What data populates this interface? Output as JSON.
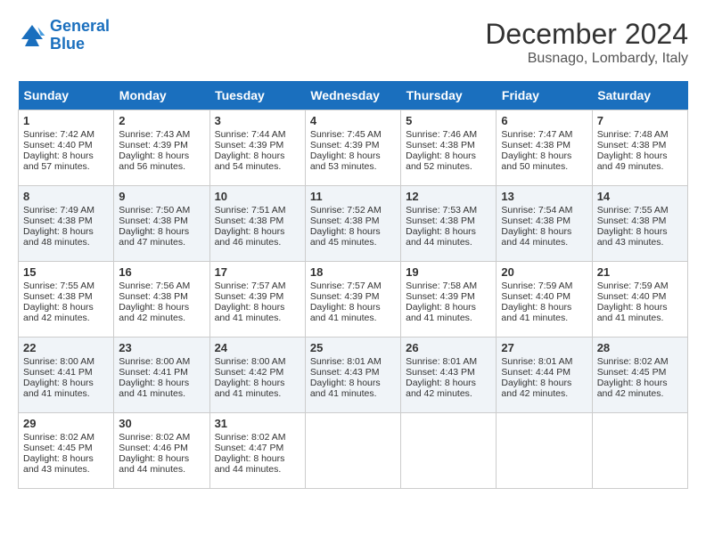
{
  "header": {
    "logo_line1": "General",
    "logo_line2": "Blue",
    "month": "December 2024",
    "location": "Busnago, Lombardy, Italy"
  },
  "weekdays": [
    "Sunday",
    "Monday",
    "Tuesday",
    "Wednesday",
    "Thursday",
    "Friday",
    "Saturday"
  ],
  "weeks": [
    [
      {
        "day": 1,
        "lines": [
          "Sunrise: 7:42 AM",
          "Sunset: 4:40 PM",
          "Daylight: 8 hours",
          "and 57 minutes."
        ]
      },
      {
        "day": 2,
        "lines": [
          "Sunrise: 7:43 AM",
          "Sunset: 4:39 PM",
          "Daylight: 8 hours",
          "and 56 minutes."
        ]
      },
      {
        "day": 3,
        "lines": [
          "Sunrise: 7:44 AM",
          "Sunset: 4:39 PM",
          "Daylight: 8 hours",
          "and 54 minutes."
        ]
      },
      {
        "day": 4,
        "lines": [
          "Sunrise: 7:45 AM",
          "Sunset: 4:39 PM",
          "Daylight: 8 hours",
          "and 53 minutes."
        ]
      },
      {
        "day": 5,
        "lines": [
          "Sunrise: 7:46 AM",
          "Sunset: 4:38 PM",
          "Daylight: 8 hours",
          "and 52 minutes."
        ]
      },
      {
        "day": 6,
        "lines": [
          "Sunrise: 7:47 AM",
          "Sunset: 4:38 PM",
          "Daylight: 8 hours",
          "and 50 minutes."
        ]
      },
      {
        "day": 7,
        "lines": [
          "Sunrise: 7:48 AM",
          "Sunset: 4:38 PM",
          "Daylight: 8 hours",
          "and 49 minutes."
        ]
      }
    ],
    [
      {
        "day": 8,
        "lines": [
          "Sunrise: 7:49 AM",
          "Sunset: 4:38 PM",
          "Daylight: 8 hours",
          "and 48 minutes."
        ]
      },
      {
        "day": 9,
        "lines": [
          "Sunrise: 7:50 AM",
          "Sunset: 4:38 PM",
          "Daylight: 8 hours",
          "and 47 minutes."
        ]
      },
      {
        "day": 10,
        "lines": [
          "Sunrise: 7:51 AM",
          "Sunset: 4:38 PM",
          "Daylight: 8 hours",
          "and 46 minutes."
        ]
      },
      {
        "day": 11,
        "lines": [
          "Sunrise: 7:52 AM",
          "Sunset: 4:38 PM",
          "Daylight: 8 hours",
          "and 45 minutes."
        ]
      },
      {
        "day": 12,
        "lines": [
          "Sunrise: 7:53 AM",
          "Sunset: 4:38 PM",
          "Daylight: 8 hours",
          "and 44 minutes."
        ]
      },
      {
        "day": 13,
        "lines": [
          "Sunrise: 7:54 AM",
          "Sunset: 4:38 PM",
          "Daylight: 8 hours",
          "and 44 minutes."
        ]
      },
      {
        "day": 14,
        "lines": [
          "Sunrise: 7:55 AM",
          "Sunset: 4:38 PM",
          "Daylight: 8 hours",
          "and 43 minutes."
        ]
      }
    ],
    [
      {
        "day": 15,
        "lines": [
          "Sunrise: 7:55 AM",
          "Sunset: 4:38 PM",
          "Daylight: 8 hours",
          "and 42 minutes."
        ]
      },
      {
        "day": 16,
        "lines": [
          "Sunrise: 7:56 AM",
          "Sunset: 4:38 PM",
          "Daylight: 8 hours",
          "and 42 minutes."
        ]
      },
      {
        "day": 17,
        "lines": [
          "Sunrise: 7:57 AM",
          "Sunset: 4:39 PM",
          "Daylight: 8 hours",
          "and 41 minutes."
        ]
      },
      {
        "day": 18,
        "lines": [
          "Sunrise: 7:57 AM",
          "Sunset: 4:39 PM",
          "Daylight: 8 hours",
          "and 41 minutes."
        ]
      },
      {
        "day": 19,
        "lines": [
          "Sunrise: 7:58 AM",
          "Sunset: 4:39 PM",
          "Daylight: 8 hours",
          "and 41 minutes."
        ]
      },
      {
        "day": 20,
        "lines": [
          "Sunrise: 7:59 AM",
          "Sunset: 4:40 PM",
          "Daylight: 8 hours",
          "and 41 minutes."
        ]
      },
      {
        "day": 21,
        "lines": [
          "Sunrise: 7:59 AM",
          "Sunset: 4:40 PM",
          "Daylight: 8 hours",
          "and 41 minutes."
        ]
      }
    ],
    [
      {
        "day": 22,
        "lines": [
          "Sunrise: 8:00 AM",
          "Sunset: 4:41 PM",
          "Daylight: 8 hours",
          "and 41 minutes."
        ]
      },
      {
        "day": 23,
        "lines": [
          "Sunrise: 8:00 AM",
          "Sunset: 4:41 PM",
          "Daylight: 8 hours",
          "and 41 minutes."
        ]
      },
      {
        "day": 24,
        "lines": [
          "Sunrise: 8:00 AM",
          "Sunset: 4:42 PM",
          "Daylight: 8 hours",
          "and 41 minutes."
        ]
      },
      {
        "day": 25,
        "lines": [
          "Sunrise: 8:01 AM",
          "Sunset: 4:43 PM",
          "Daylight: 8 hours",
          "and 41 minutes."
        ]
      },
      {
        "day": 26,
        "lines": [
          "Sunrise: 8:01 AM",
          "Sunset: 4:43 PM",
          "Daylight: 8 hours",
          "and 42 minutes."
        ]
      },
      {
        "day": 27,
        "lines": [
          "Sunrise: 8:01 AM",
          "Sunset: 4:44 PM",
          "Daylight: 8 hours",
          "and 42 minutes."
        ]
      },
      {
        "day": 28,
        "lines": [
          "Sunrise: 8:02 AM",
          "Sunset: 4:45 PM",
          "Daylight: 8 hours",
          "and 42 minutes."
        ]
      }
    ],
    [
      {
        "day": 29,
        "lines": [
          "Sunrise: 8:02 AM",
          "Sunset: 4:45 PM",
          "Daylight: 8 hours",
          "and 43 minutes."
        ]
      },
      {
        "day": 30,
        "lines": [
          "Sunrise: 8:02 AM",
          "Sunset: 4:46 PM",
          "Daylight: 8 hours",
          "and 44 minutes."
        ]
      },
      {
        "day": 31,
        "lines": [
          "Sunrise: 8:02 AM",
          "Sunset: 4:47 PM",
          "Daylight: 8 hours",
          "and 44 minutes."
        ]
      },
      null,
      null,
      null,
      null
    ]
  ]
}
